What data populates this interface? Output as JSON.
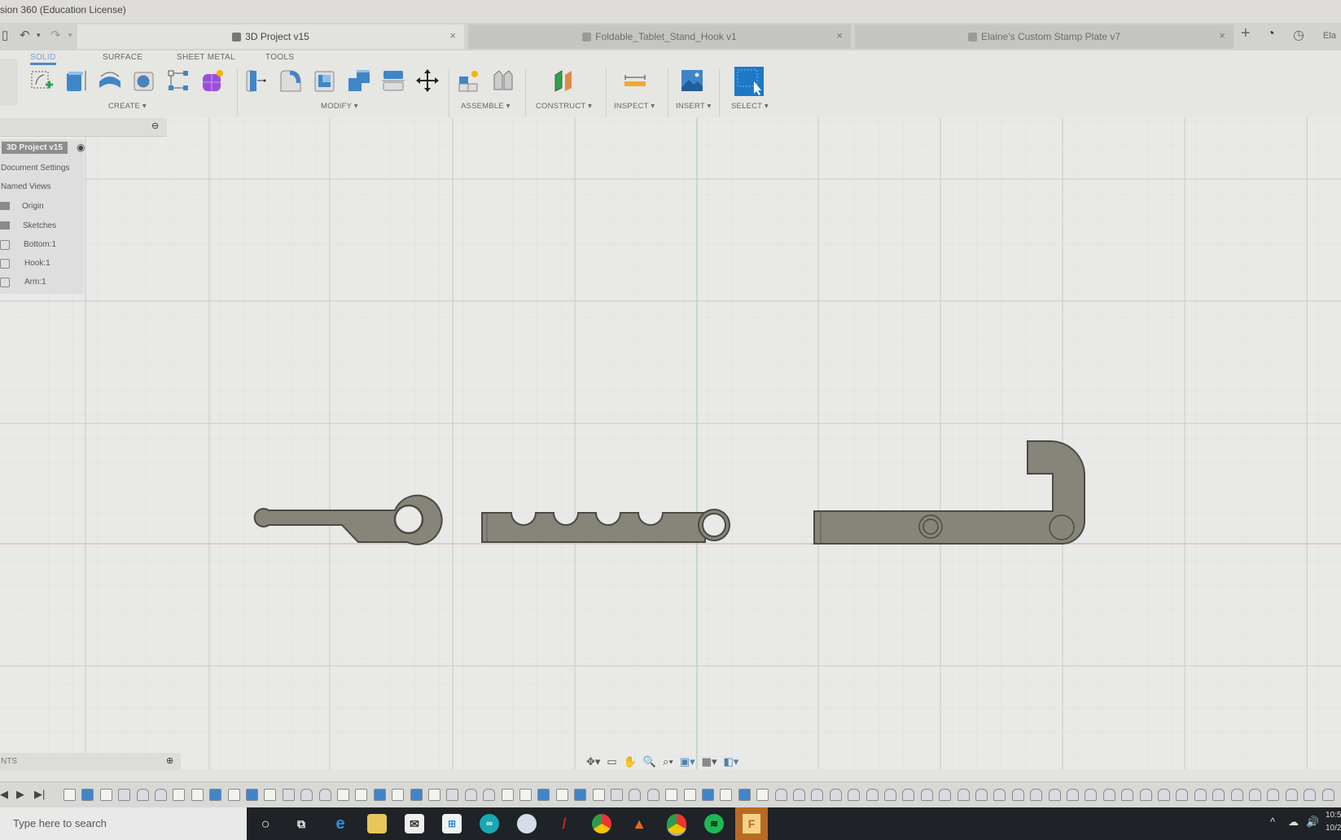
{
  "window": {
    "title": "sion 360 (Education License)"
  },
  "quick_access": {
    "undo_icon": "↶",
    "redo_icon": "↷",
    "dropdown": "▾"
  },
  "tabs": [
    {
      "label": "3D Project v15",
      "active": true,
      "close": "×"
    },
    {
      "label": "Foldable_Tablet_Stand_Hook v1",
      "active": false,
      "close": "×"
    },
    {
      "label": "Elaine's Custom Stamp Plate v7",
      "active": false,
      "close": "×"
    }
  ],
  "tab_actions": {
    "new_tab": "+",
    "job_status": "◔",
    "notifications": "◷",
    "user": "Ela"
  },
  "workspace_tabs": [
    "SOLID",
    "SURFACE",
    "SHEET METAL",
    "TOOLS"
  ],
  "toolbar_groups": [
    {
      "label": "CREATE ▾",
      "tools": [
        "create-sketch",
        "extrude",
        "revolve",
        "hole",
        "pattern",
        "create-form"
      ]
    },
    {
      "label": "MODIFY ▾",
      "tools": [
        "press-pull",
        "fillet",
        "shell",
        "combine",
        "split-body",
        "move"
      ]
    },
    {
      "label": "ASSEMBLE ▾",
      "tools": [
        "new-component",
        "joint"
      ]
    },
    {
      "label": "CONSTRUCT ▾",
      "tools": [
        "offset-plane"
      ]
    },
    {
      "label": "INSPECT ▾",
      "tools": [
        "measure"
      ]
    },
    {
      "label": "INSERT ▾",
      "tools": [
        "insert-image"
      ]
    },
    {
      "label": "SELECT ▾",
      "tools": [
        "select"
      ]
    }
  ],
  "browser": {
    "root": "3D Project v15",
    "items": [
      {
        "label": "Document Settings",
        "icon": "none"
      },
      {
        "label": "Named Views",
        "icon": "none"
      },
      {
        "label": "Origin",
        "icon": "folder"
      },
      {
        "label": "Sketches",
        "icon": "folder"
      },
      {
        "label": "Bottom:1",
        "icon": "component"
      },
      {
        "label": "Hook:1",
        "icon": "component"
      },
      {
        "label": "Arm:1",
        "icon": "component"
      }
    ]
  },
  "comments": {
    "label": "NTS"
  },
  "navbar": {
    "orbit": "✥▾",
    "look_at": "▭",
    "pan": "✋",
    "zoom": "🔍",
    "fit": "⌕▾",
    "display": "▣▾",
    "grid": "▦▾",
    "viewports": "◧▾"
  },
  "timeline": {
    "play_back": "◀",
    "play": "▶",
    "end": "▶|",
    "feature_count": 70
  },
  "taskbar": {
    "search_placeholder": "Type here to search",
    "apps": [
      "cortana",
      "task-view",
      "edge",
      "file-explorer",
      "mail",
      "store",
      "arduino",
      "paint-3d",
      "acrobat",
      "chrome",
      "matlab",
      "chrome-profile",
      "spotify",
      "fusion-360"
    ],
    "clock_time": "10:5",
    "clock_date": "10/2",
    "tray": {
      "chevron": "^",
      "cloud": "☁",
      "volume": "🔊"
    }
  },
  "colors": {
    "accent": "#4f88c6",
    "part_fill": "#87847a",
    "part_edge": "#4a4a46",
    "grid_major": "#cfd2cf"
  }
}
